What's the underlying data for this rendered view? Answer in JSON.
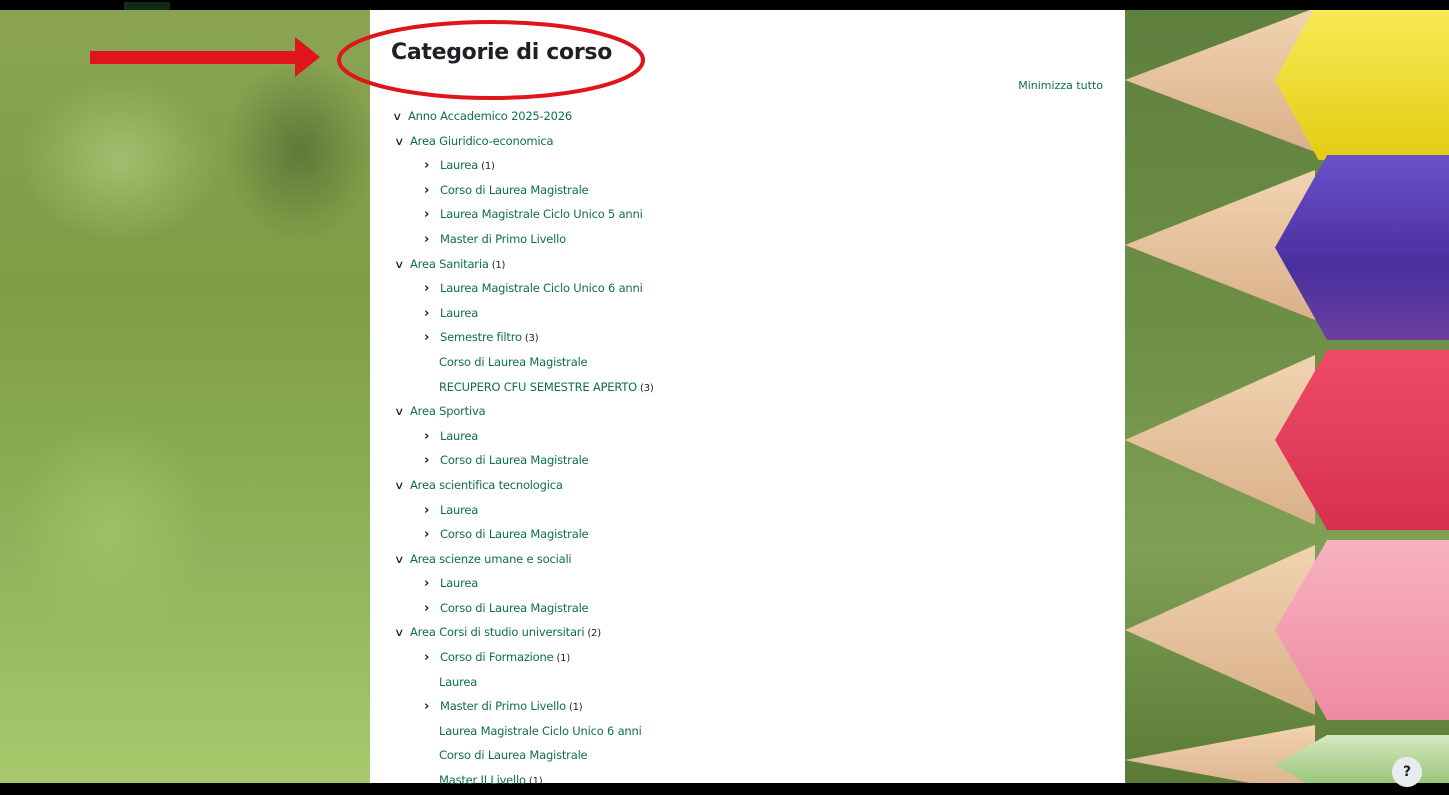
{
  "page": {
    "title": "Categorie di corso",
    "collapse_all": "Minimizza tutto"
  },
  "tree": [
    {
      "level": 0,
      "icon": "chevron-down",
      "label": "Anno Accademico 2025-2026",
      "count": ""
    },
    {
      "level": 1,
      "icon": "chevron-down",
      "label": "Area Giuridico-economica",
      "count": ""
    },
    {
      "level": 2,
      "icon": "chevron-right",
      "label": "Laurea",
      "count": "(1)"
    },
    {
      "level": 2,
      "icon": "chevron-right",
      "label": "Corso di Laurea Magistrale",
      "count": ""
    },
    {
      "level": 2,
      "icon": "chevron-right",
      "label": "Laurea Magistrale Ciclo Unico 5 anni",
      "count": ""
    },
    {
      "level": 2,
      "icon": "chevron-right",
      "label": "Master di Primo Livello",
      "count": ""
    },
    {
      "level": 1,
      "icon": "chevron-down",
      "label": "Area Sanitaria",
      "count": "(1)"
    },
    {
      "level": 2,
      "icon": "chevron-right",
      "label": "Laurea Magistrale Ciclo Unico 6 anni",
      "count": ""
    },
    {
      "level": 2,
      "icon": "chevron-right",
      "label": "Laurea",
      "count": ""
    },
    {
      "level": 2,
      "icon": "chevron-right",
      "label": "Semestre filtro",
      "count": "(3)"
    },
    {
      "level": 2,
      "icon": "",
      "label": "Corso di Laurea Magistrale",
      "count": "",
      "muted": true
    },
    {
      "level": 2,
      "icon": "",
      "label": "RECUPERO CFU SEMESTRE APERTO",
      "count": "(3)"
    },
    {
      "level": 1,
      "icon": "chevron-down",
      "label": "Area Sportiva",
      "count": ""
    },
    {
      "level": 2,
      "icon": "chevron-right",
      "label": "Laurea",
      "count": ""
    },
    {
      "level": 2,
      "icon": "chevron-right",
      "label": "Corso di Laurea Magistrale",
      "count": ""
    },
    {
      "level": 1,
      "icon": "chevron-down",
      "label": "Area scientifica tecnologica",
      "count": ""
    },
    {
      "level": 2,
      "icon": "chevron-right",
      "label": "Laurea",
      "count": ""
    },
    {
      "level": 2,
      "icon": "chevron-right",
      "label": "Corso di Laurea Magistrale",
      "count": ""
    },
    {
      "level": 1,
      "icon": "chevron-down",
      "label": "Area scienze umane e sociali",
      "count": ""
    },
    {
      "level": 2,
      "icon": "chevron-right",
      "label": "Laurea",
      "count": ""
    },
    {
      "level": 2,
      "icon": "chevron-right",
      "label": "Corso di Laurea Magistrale",
      "count": ""
    },
    {
      "level": 1,
      "icon": "chevron-down",
      "label": "Area Corsi di studio universitari",
      "count": "(2)"
    },
    {
      "level": 2,
      "icon": "chevron-right",
      "label": "Corso di Formazione",
      "count": "(1)"
    },
    {
      "level": 2,
      "icon": "",
      "label": "Laurea",
      "count": "",
      "muted": true
    },
    {
      "level": 2,
      "icon": "chevron-right",
      "label": "Master di Primo Livello",
      "count": "(1)"
    },
    {
      "level": 2,
      "icon": "",
      "label": "Laurea Magistrale Ciclo Unico 6 anni",
      "count": "",
      "muted": true
    },
    {
      "level": 2,
      "icon": "",
      "label": "Corso di Laurea Magistrale",
      "count": "",
      "muted": true
    },
    {
      "level": 2,
      "icon": "",
      "label": "Master II Livello",
      "count": "(1)"
    }
  ],
  "help": {
    "label": "?"
  },
  "colors": {
    "link": "#0f6e4d",
    "muted": "#6a737b",
    "annotation": "#e0141b",
    "pencils": [
      "#f4e22b",
      "#5b3fb8",
      "#e83f5b",
      "#f29aae"
    ]
  }
}
